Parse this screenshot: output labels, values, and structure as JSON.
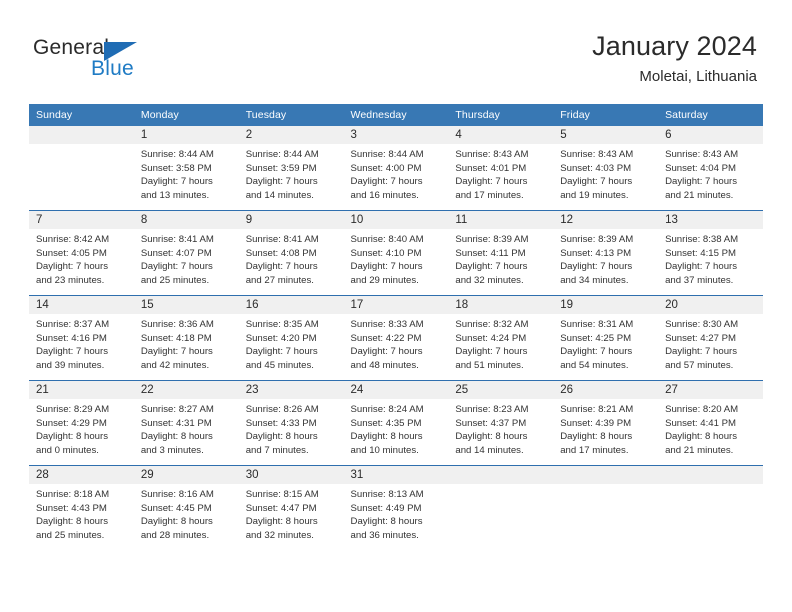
{
  "brand": {
    "name_part1": "General",
    "name_part2": "Blue",
    "logo_icon": "triangle-logo-icon",
    "accent_color": "#1f7bc4"
  },
  "header": {
    "title": "January 2024",
    "location": "Moletai, Lithuania"
  },
  "calendar": {
    "header_bg": "#3878b4",
    "header_text_color": "#ffffff",
    "row_divider_color": "#2f6fae",
    "daynum_band_color": "#f0f0f0",
    "weekdays": [
      "Sunday",
      "Monday",
      "Tuesday",
      "Wednesday",
      "Thursday",
      "Friday",
      "Saturday"
    ],
    "weeks": [
      [
        {
          "day": "",
          "lines": []
        },
        {
          "day": "1",
          "lines": [
            "Sunrise: 8:44 AM",
            "Sunset: 3:58 PM",
            "Daylight: 7 hours",
            "and 13 minutes."
          ]
        },
        {
          "day": "2",
          "lines": [
            "Sunrise: 8:44 AM",
            "Sunset: 3:59 PM",
            "Daylight: 7 hours",
            "and 14 minutes."
          ]
        },
        {
          "day": "3",
          "lines": [
            "Sunrise: 8:44 AM",
            "Sunset: 4:00 PM",
            "Daylight: 7 hours",
            "and 16 minutes."
          ]
        },
        {
          "day": "4",
          "lines": [
            "Sunrise: 8:43 AM",
            "Sunset: 4:01 PM",
            "Daylight: 7 hours",
            "and 17 minutes."
          ]
        },
        {
          "day": "5",
          "lines": [
            "Sunrise: 8:43 AM",
            "Sunset: 4:03 PM",
            "Daylight: 7 hours",
            "and 19 minutes."
          ]
        },
        {
          "day": "6",
          "lines": [
            "Sunrise: 8:43 AM",
            "Sunset: 4:04 PM",
            "Daylight: 7 hours",
            "and 21 minutes."
          ]
        }
      ],
      [
        {
          "day": "7",
          "lines": [
            "Sunrise: 8:42 AM",
            "Sunset: 4:05 PM",
            "Daylight: 7 hours",
            "and 23 minutes."
          ]
        },
        {
          "day": "8",
          "lines": [
            "Sunrise: 8:41 AM",
            "Sunset: 4:07 PM",
            "Daylight: 7 hours",
            "and 25 minutes."
          ]
        },
        {
          "day": "9",
          "lines": [
            "Sunrise: 8:41 AM",
            "Sunset: 4:08 PM",
            "Daylight: 7 hours",
            "and 27 minutes."
          ]
        },
        {
          "day": "10",
          "lines": [
            "Sunrise: 8:40 AM",
            "Sunset: 4:10 PM",
            "Daylight: 7 hours",
            "and 29 minutes."
          ]
        },
        {
          "day": "11",
          "lines": [
            "Sunrise: 8:39 AM",
            "Sunset: 4:11 PM",
            "Daylight: 7 hours",
            "and 32 minutes."
          ]
        },
        {
          "day": "12",
          "lines": [
            "Sunrise: 8:39 AM",
            "Sunset: 4:13 PM",
            "Daylight: 7 hours",
            "and 34 minutes."
          ]
        },
        {
          "day": "13",
          "lines": [
            "Sunrise: 8:38 AM",
            "Sunset: 4:15 PM",
            "Daylight: 7 hours",
            "and 37 minutes."
          ]
        }
      ],
      [
        {
          "day": "14",
          "lines": [
            "Sunrise: 8:37 AM",
            "Sunset: 4:16 PM",
            "Daylight: 7 hours",
            "and 39 minutes."
          ]
        },
        {
          "day": "15",
          "lines": [
            "Sunrise: 8:36 AM",
            "Sunset: 4:18 PM",
            "Daylight: 7 hours",
            "and 42 minutes."
          ]
        },
        {
          "day": "16",
          "lines": [
            "Sunrise: 8:35 AM",
            "Sunset: 4:20 PM",
            "Daylight: 7 hours",
            "and 45 minutes."
          ]
        },
        {
          "day": "17",
          "lines": [
            "Sunrise: 8:33 AM",
            "Sunset: 4:22 PM",
            "Daylight: 7 hours",
            "and 48 minutes."
          ]
        },
        {
          "day": "18",
          "lines": [
            "Sunrise: 8:32 AM",
            "Sunset: 4:24 PM",
            "Daylight: 7 hours",
            "and 51 minutes."
          ]
        },
        {
          "day": "19",
          "lines": [
            "Sunrise: 8:31 AM",
            "Sunset: 4:25 PM",
            "Daylight: 7 hours",
            "and 54 minutes."
          ]
        },
        {
          "day": "20",
          "lines": [
            "Sunrise: 8:30 AM",
            "Sunset: 4:27 PM",
            "Daylight: 7 hours",
            "and 57 minutes."
          ]
        }
      ],
      [
        {
          "day": "21",
          "lines": [
            "Sunrise: 8:29 AM",
            "Sunset: 4:29 PM",
            "Daylight: 8 hours",
            "and 0 minutes."
          ]
        },
        {
          "day": "22",
          "lines": [
            "Sunrise: 8:27 AM",
            "Sunset: 4:31 PM",
            "Daylight: 8 hours",
            "and 3 minutes."
          ]
        },
        {
          "day": "23",
          "lines": [
            "Sunrise: 8:26 AM",
            "Sunset: 4:33 PM",
            "Daylight: 8 hours",
            "and 7 minutes."
          ]
        },
        {
          "day": "24",
          "lines": [
            "Sunrise: 8:24 AM",
            "Sunset: 4:35 PM",
            "Daylight: 8 hours",
            "and 10 minutes."
          ]
        },
        {
          "day": "25",
          "lines": [
            "Sunrise: 8:23 AM",
            "Sunset: 4:37 PM",
            "Daylight: 8 hours",
            "and 14 minutes."
          ]
        },
        {
          "day": "26",
          "lines": [
            "Sunrise: 8:21 AM",
            "Sunset: 4:39 PM",
            "Daylight: 8 hours",
            "and 17 minutes."
          ]
        },
        {
          "day": "27",
          "lines": [
            "Sunrise: 8:20 AM",
            "Sunset: 4:41 PM",
            "Daylight: 8 hours",
            "and 21 minutes."
          ]
        }
      ],
      [
        {
          "day": "28",
          "lines": [
            "Sunrise: 8:18 AM",
            "Sunset: 4:43 PM",
            "Daylight: 8 hours",
            "and 25 minutes."
          ]
        },
        {
          "day": "29",
          "lines": [
            "Sunrise: 8:16 AM",
            "Sunset: 4:45 PM",
            "Daylight: 8 hours",
            "and 28 minutes."
          ]
        },
        {
          "day": "30",
          "lines": [
            "Sunrise: 8:15 AM",
            "Sunset: 4:47 PM",
            "Daylight: 8 hours",
            "and 32 minutes."
          ]
        },
        {
          "day": "31",
          "lines": [
            "Sunrise: 8:13 AM",
            "Sunset: 4:49 PM",
            "Daylight: 8 hours",
            "and 36 minutes."
          ]
        },
        {
          "day": "",
          "lines": []
        },
        {
          "day": "",
          "lines": []
        },
        {
          "day": "",
          "lines": []
        }
      ]
    ]
  }
}
